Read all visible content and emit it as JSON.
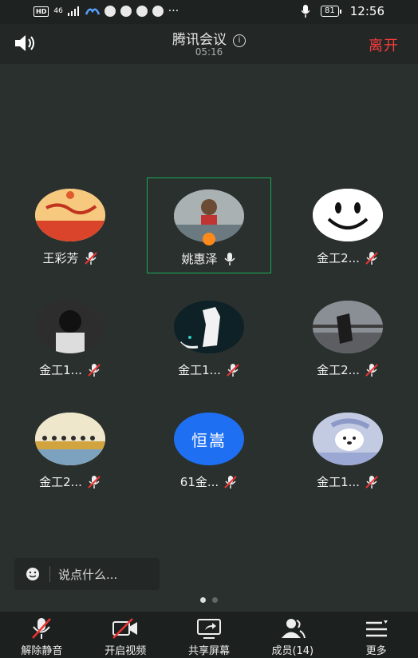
{
  "status_bar": {
    "hd": "HD",
    "signal": "46",
    "battery": "81",
    "time": "12:56",
    "icons": [
      "signal-icon",
      "app-icon",
      "chat-icon",
      "camera-icon",
      "message-icon",
      "mail-icon",
      "more-icon",
      "mic-icon",
      "battery-icon"
    ]
  },
  "header": {
    "title": "腾讯会议",
    "timer": "05:16",
    "leave_label": "离开",
    "info_symbol": "i"
  },
  "participants": [
    {
      "name": "王彩芳",
      "muted": true
    },
    {
      "name": "姚惠泽",
      "muted": false,
      "speaking": true,
      "host": true
    },
    {
      "name": "金工2...",
      "muted": true
    },
    {
      "name": "金工1...",
      "muted": true
    },
    {
      "name": "金工1...",
      "muted": true
    },
    {
      "name": "金工2...",
      "muted": true
    },
    {
      "name": "金工2...",
      "muted": true
    },
    {
      "name": "61金...",
      "muted": true,
      "avatar_text": "恒嵩"
    },
    {
      "name": "金工1...",
      "muted": true
    }
  ],
  "chat": {
    "placeholder": "说点什么..."
  },
  "pager": {
    "pages": 2,
    "current": 1
  },
  "toolbar": {
    "unmute": "解除静音",
    "video": "开启视频",
    "share": "共享屏幕",
    "members": "成员(14)",
    "more": "更多"
  },
  "colors": {
    "background": "#2a302e",
    "leave": "#ff3b3b",
    "active_border": "#1aaa55",
    "avatar_blue": "#1e6ff2"
  }
}
